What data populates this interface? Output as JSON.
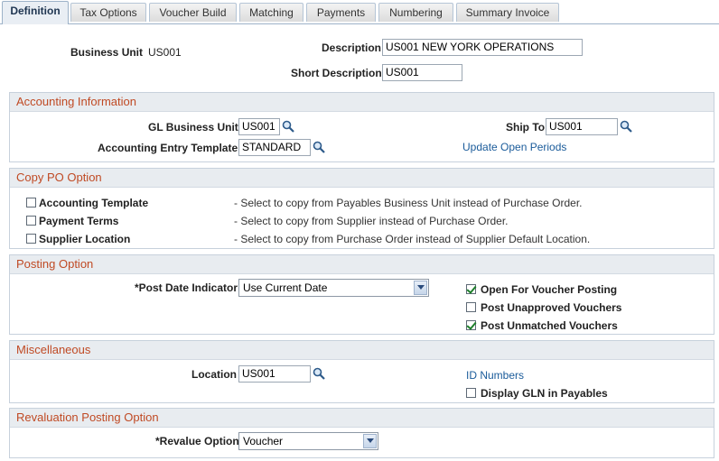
{
  "tabs": [
    {
      "label": "Definition",
      "active": true
    },
    {
      "label": "Tax Options"
    },
    {
      "label": "Voucher Build"
    },
    {
      "label": "Matching"
    },
    {
      "label": "Payments"
    },
    {
      "label": "Numbering"
    },
    {
      "label": "Summary Invoice"
    }
  ],
  "header": {
    "business_unit_label": "Business Unit",
    "business_unit_value": "US001",
    "description_label": "Description",
    "description_value": "US001 NEW YORK OPERATIONS",
    "short_description_label": "Short Description",
    "short_description_value": "US001"
  },
  "accounting": {
    "title": "Accounting Information",
    "gl_bu_label": "GL Business Unit",
    "gl_bu_value": "US001",
    "ship_to_label": "Ship To",
    "ship_to_value": "US001",
    "template_label": "Accounting Entry Template",
    "template_value": "STANDARD",
    "update_link": "Update Open Periods"
  },
  "copy_po": {
    "title": "Copy PO Option",
    "options": [
      {
        "label": "Accounting Template",
        "desc": "- Select to copy from Payables Business Unit instead of Purchase Order.",
        "checked": false
      },
      {
        "label": "Payment Terms",
        "desc": "- Select to copy from Supplier instead of Purchase Order.",
        "checked": false
      },
      {
        "label": "Supplier Location",
        "desc": "- Select to copy from Purchase Order instead of Supplier Default Location.",
        "checked": false
      }
    ]
  },
  "posting": {
    "title": "Posting Option",
    "post_date_label": "*Post Date Indicator",
    "post_date_value": "Use Current Date",
    "checks": [
      {
        "label": "Open For Voucher Posting",
        "checked": true
      },
      {
        "label": "Post Unapproved Vouchers",
        "checked": false
      },
      {
        "label": "Post Unmatched Vouchers",
        "checked": true
      }
    ]
  },
  "misc": {
    "title": "Miscellaneous",
    "location_label": "Location",
    "location_value": "US001",
    "id_link": "ID Numbers",
    "gln_label": "Display GLN in Payables",
    "gln_checked": false
  },
  "reval": {
    "title": "Revaluation Posting Option",
    "revalue_label": "*Revalue Option",
    "revalue_value": "Voucher"
  }
}
